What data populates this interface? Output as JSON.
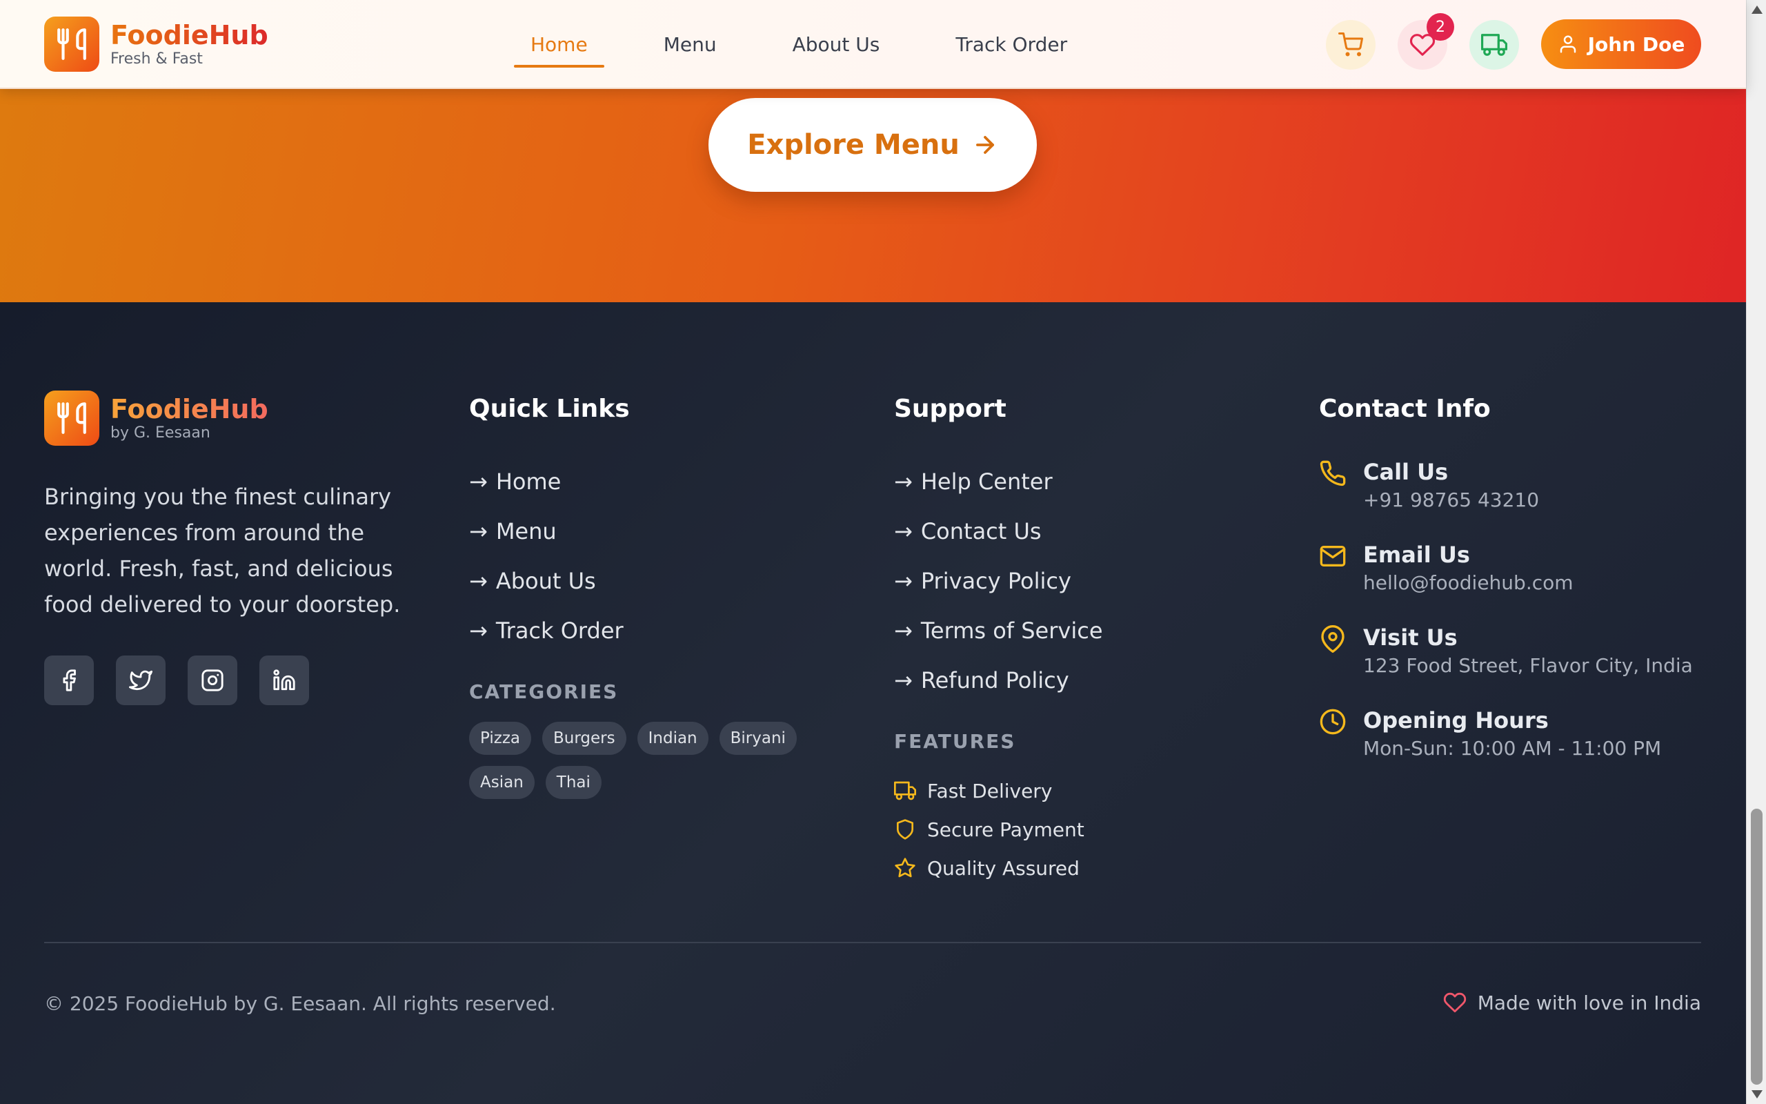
{
  "header": {
    "brand": "FoodieHub",
    "tagline": "Fresh & Fast",
    "nav": [
      {
        "label": "Home",
        "active": true
      },
      {
        "label": "Menu",
        "active": false
      },
      {
        "label": "About Us",
        "active": false
      },
      {
        "label": "Track Order",
        "active": false
      }
    ],
    "icons": {
      "cart": "cart-icon",
      "favorites": "heart-icon",
      "track": "truck-icon"
    },
    "favorites_count": "2",
    "user_name": "John Doe"
  },
  "hero": {
    "cta_label": "Explore Menu"
  },
  "footer": {
    "brand": "FoodieHub",
    "byline": "by G. Eesaan",
    "description": "Bringing you the finest culinary experiences from around the world. Fresh, fast, and delicious food delivered to your doorstep.",
    "socials": [
      "facebook-icon",
      "twitter-icon",
      "instagram-icon",
      "linkedin-icon"
    ],
    "quick_links": {
      "title": "Quick Links",
      "items": [
        "Home",
        "Menu",
        "About Us",
        "Track Order"
      ]
    },
    "categories": {
      "title": "CATEGORIES",
      "items": [
        "Pizza",
        "Burgers",
        "Indian",
        "Biryani",
        "Asian",
        "Thai"
      ]
    },
    "support": {
      "title": "Support",
      "items": [
        "Help Center",
        "Contact Us",
        "Privacy Policy",
        "Terms of Service",
        "Refund Policy"
      ]
    },
    "features": {
      "title": "FEATURES",
      "items": [
        "Fast Delivery",
        "Secure Payment",
        "Quality Assured"
      ]
    },
    "contact": {
      "title": "Contact Info",
      "items": [
        {
          "label": "Call Us",
          "value": "+91 98765 43210",
          "icon": "phone-icon"
        },
        {
          "label": "Email Us",
          "value": "hello@foodiehub.com",
          "icon": "mail-icon"
        },
        {
          "label": "Visit Us",
          "value": "123 Food Street, Flavor City, India",
          "icon": "map-pin-icon"
        },
        {
          "label": "Opening Hours",
          "value": "Mon-Sun: 10:00 AM - 11:00 PM",
          "icon": "clock-icon"
        }
      ]
    },
    "copyright": "© 2025 FoodieHub by G. Eesaan. All rights reserved.",
    "made_with": "Made with love in India"
  },
  "colors": {
    "accent": "#e67a12",
    "hero_start": "#de7a0f",
    "hero_end": "#df2525",
    "footer_bg": "#1e2432",
    "icon_gold": "#f5b81c",
    "badge": "#e2244f"
  }
}
